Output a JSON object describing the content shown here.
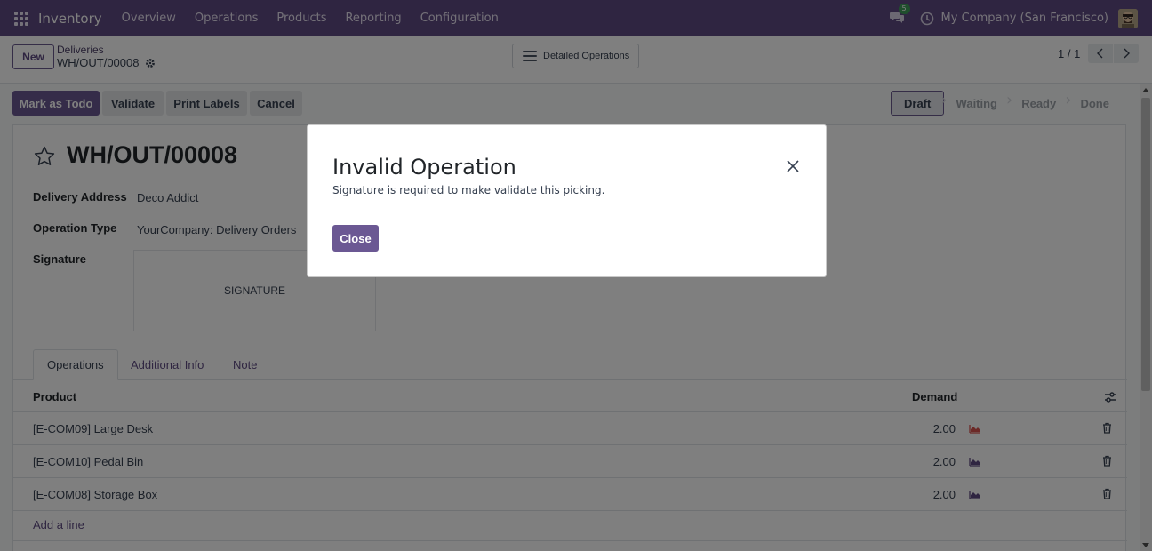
{
  "navbar": {
    "app_name": "Inventory",
    "menu": [
      "Overview",
      "Operations",
      "Products",
      "Reporting",
      "Configuration"
    ],
    "chat_count": "5",
    "company": "My Company (San Francisco)"
  },
  "control_panel": {
    "new_label": "New",
    "breadcrumb_parent": "Deliveries",
    "breadcrumb_current": "WH/OUT/00008",
    "detailed_operations_label": "Detailed Operations",
    "pager": "1 / 1"
  },
  "actions": {
    "mark_todo": "Mark as Todo",
    "validate": "Validate",
    "print_labels": "Print Labels",
    "cancel": "Cancel"
  },
  "status_stages": [
    "Draft",
    "Waiting",
    "Ready",
    "Done"
  ],
  "status_active": "Draft",
  "record": {
    "title": "WH/OUT/00008",
    "fields": {
      "delivery_address_label": "Delivery Address",
      "delivery_address_value": "Deco Addict",
      "operation_type_label": "Operation Type",
      "operation_type_value": "YourCompany: Delivery Orders",
      "signature_label": "Signature",
      "signature_placeholder": "SIGNATURE"
    }
  },
  "tabs": [
    "Operations",
    "Additional Info",
    "Note"
  ],
  "table": {
    "columns": {
      "product": "Product",
      "demand": "Demand"
    },
    "rows": [
      {
        "product": "[E-COM09] Large Desk",
        "demand": "2.00",
        "forecast_color": "#d9534f"
      },
      {
        "product": "[E-COM10] Pedal Bin",
        "demand": "2.00",
        "forecast_color": "#5f4b82"
      },
      {
        "product": "[E-COM08] Storage Box",
        "demand": "2.00",
        "forecast_color": "#5f4b82"
      }
    ],
    "add_line": "Add a line"
  },
  "modal": {
    "title": "Invalid Operation",
    "message": "Signature is required to make validate this picking.",
    "close_label": "Close"
  },
  "colors": {
    "brand": "#5f4b82",
    "primary_button": "#6b5893"
  }
}
